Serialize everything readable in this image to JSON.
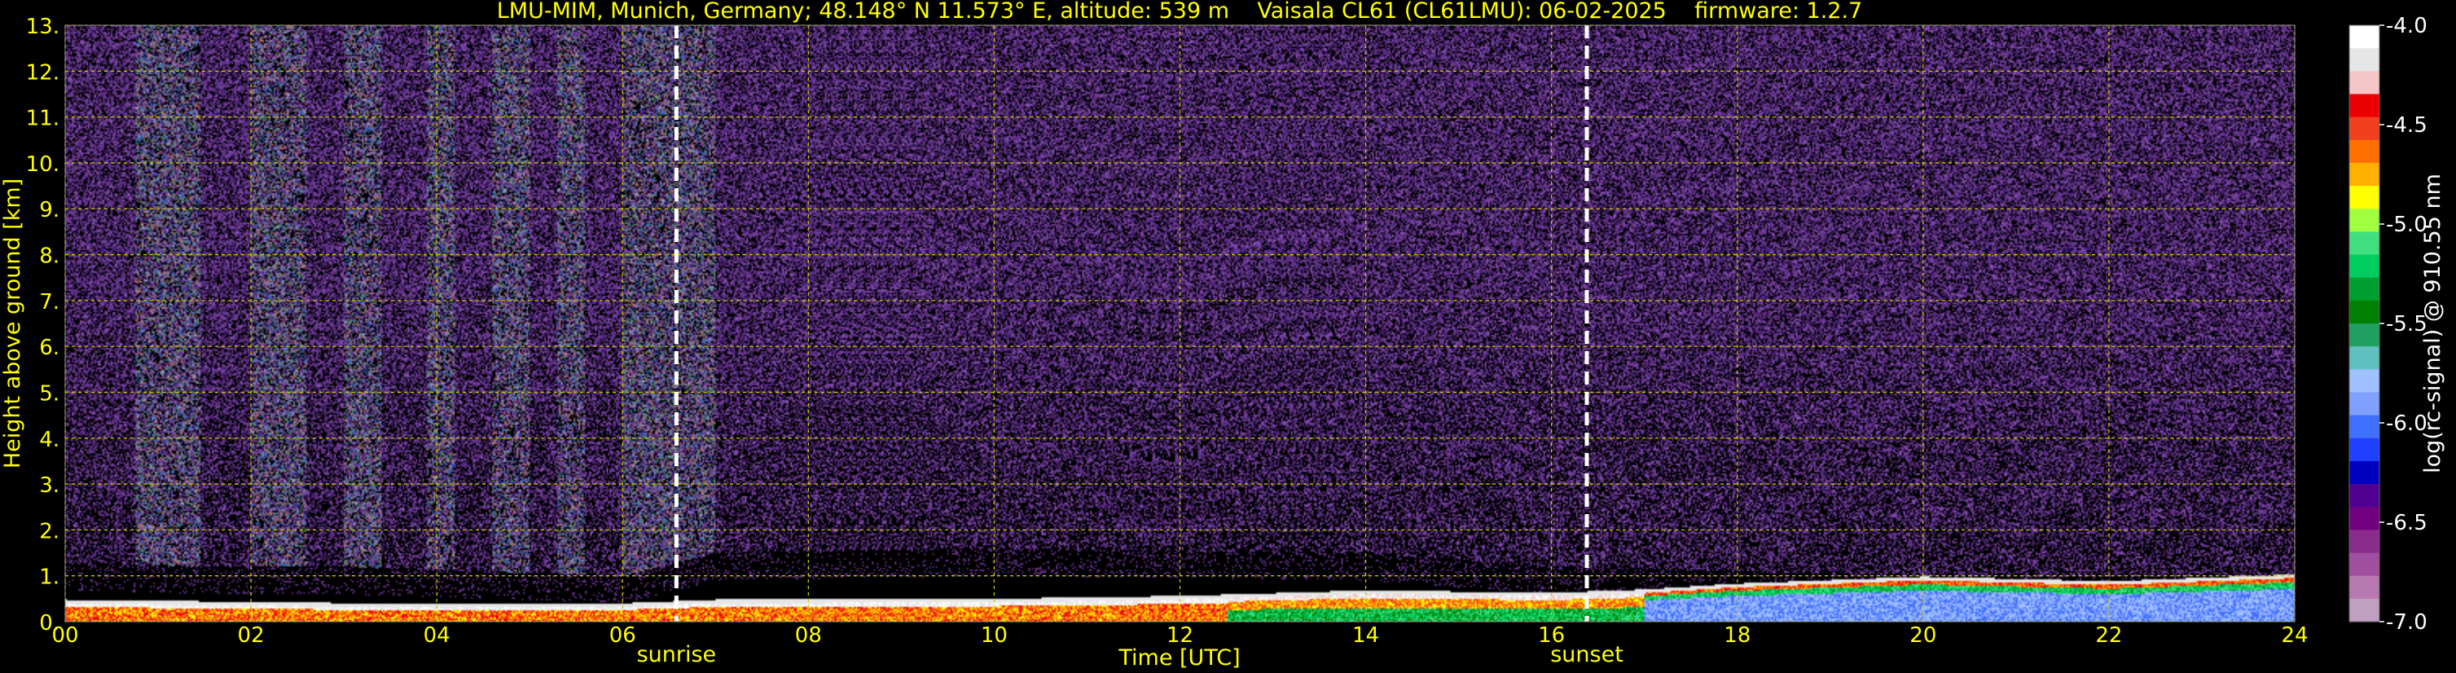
{
  "chart_data": {
    "type": "heatmap",
    "title": "LMU-MIM, Munich, Germany; 48.148° N 11.573° E, altitude: 539 m    Vaisala CL61 (CL61LMU): 06-02-2025    firmware: 1.2.7",
    "xlabel": "Time [UTC]",
    "ylabel": "Height above ground [km]",
    "xlim": [
      0,
      24
    ],
    "ylim": [
      0,
      13
    ],
    "x_ticks": [
      "00",
      "02",
      "04",
      "06",
      "08",
      "10",
      "12",
      "14",
      "16",
      "18",
      "20",
      "22",
      "24"
    ],
    "y_ticks": [
      "0.",
      "1.",
      "2.",
      "3.",
      "4.",
      "5.",
      "6.",
      "7.",
      "8.",
      "9.",
      "10.",
      "11.",
      "12.",
      "13."
    ],
    "grid": true,
    "colorbar": {
      "label": "log(rc-signal) @ 910.55 nm",
      "range": [
        -7.0,
        -4.0
      ],
      "ticks": [
        "-4.0",
        "-4.5",
        "-5.0",
        "-5.5",
        "-6.0",
        "-6.5",
        "-7.0"
      ],
      "colors": [
        "#ffffff",
        "#e6e6e6",
        "#f4c6c6",
        "#ee0000",
        "#f04020",
        "#ff7000",
        "#ffb000",
        "#ffff00",
        "#a0ff40",
        "#40e080",
        "#00cc60",
        "#00a030",
        "#008000",
        "#20a060",
        "#60c0c0",
        "#a0c0ff",
        "#80a0ff",
        "#4070ff",
        "#2040ff",
        "#0000c0",
        "#500090",
        "#700080",
        "#8a2a8a",
        "#a050a0",
        "#b878b0",
        "#c0a0c0"
      ]
    },
    "events": [
      {
        "label": "sunrise",
        "time_utc": 6.58
      },
      {
        "label": "sunset",
        "time_utc": 16.38
      }
    ],
    "layers": {
      "boundary_layer_top_km": [
        {
          "t": 0.0,
          "h": 0.4
        },
        {
          "t": 2.0,
          "h": 0.35
        },
        {
          "t": 4.0,
          "h": 0.3
        },
        {
          "t": 6.0,
          "h": 0.32
        },
        {
          "t": 7.0,
          "h": 0.4
        },
        {
          "t": 10.0,
          "h": 0.42
        },
        {
          "t": 12.0,
          "h": 0.48
        },
        {
          "t": 14.0,
          "h": 0.6
        },
        {
          "t": 16.0,
          "h": 0.55
        },
        {
          "t": 17.0,
          "h": 0.62
        },
        {
          "t": 18.0,
          "h": 0.75
        },
        {
          "t": 20.0,
          "h": 0.9
        },
        {
          "t": 22.0,
          "h": 0.8
        },
        {
          "t": 24.0,
          "h": 0.95
        }
      ],
      "noise_bottom_km": [
        {
          "t": 0.0,
          "h": 1.3
        },
        {
          "t": 1.5,
          "h": 1.2
        },
        {
          "t": 3.0,
          "h": 1.2
        },
        {
          "t": 6.0,
          "h": 1.0
        },
        {
          "t": 7.0,
          "h": 1.5
        },
        {
          "t": 10.0,
          "h": 1.6
        },
        {
          "t": 14.0,
          "h": 1.5
        },
        {
          "t": 16.0,
          "h": 1.2
        },
        {
          "t": 20.0,
          "h": 1.0
        },
        {
          "t": 24.0,
          "h": 1.0
        }
      ],
      "bright_noise_periods_utc": [
        [
          0.75,
          1.45
        ],
        [
          2.0,
          2.6
        ],
        [
          3.0,
          3.4
        ],
        [
          3.9,
          4.2
        ],
        [
          4.6,
          5.0
        ],
        [
          5.3,
          5.6
        ],
        [
          6.0,
          7.0
        ]
      ]
    }
  }
}
